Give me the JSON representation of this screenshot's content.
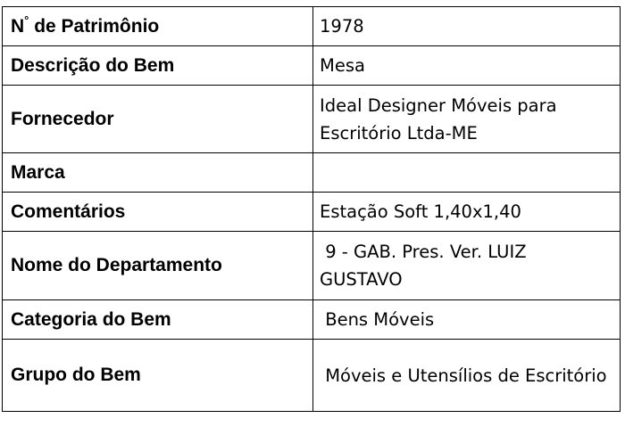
{
  "rows": [
    {
      "label_prefix": "N",
      "label_mark": "°",
      "label_rest": " de Patrimônio",
      "value": "1978"
    },
    {
      "label": "Descrição do Bem",
      "value": "Mesa"
    },
    {
      "label": "Fornecedor",
      "value": "Ideal Designer Móveis para Escritório Ltda-ME"
    },
    {
      "label": "Marca",
      "value": ""
    },
    {
      "label": "Comentários",
      "value": "Estação Soft 1,40x1,40"
    },
    {
      "label": "Nome do Departamento",
      "value": " 9 - GAB. Pres. Ver. LUIZ GUSTAVO"
    },
    {
      "label": "Categoria do Bem",
      "value": " Bens Móveis"
    },
    {
      "label": "Grupo do Bem",
      "value": " Móveis e Utensílios de Escritório"
    }
  ]
}
